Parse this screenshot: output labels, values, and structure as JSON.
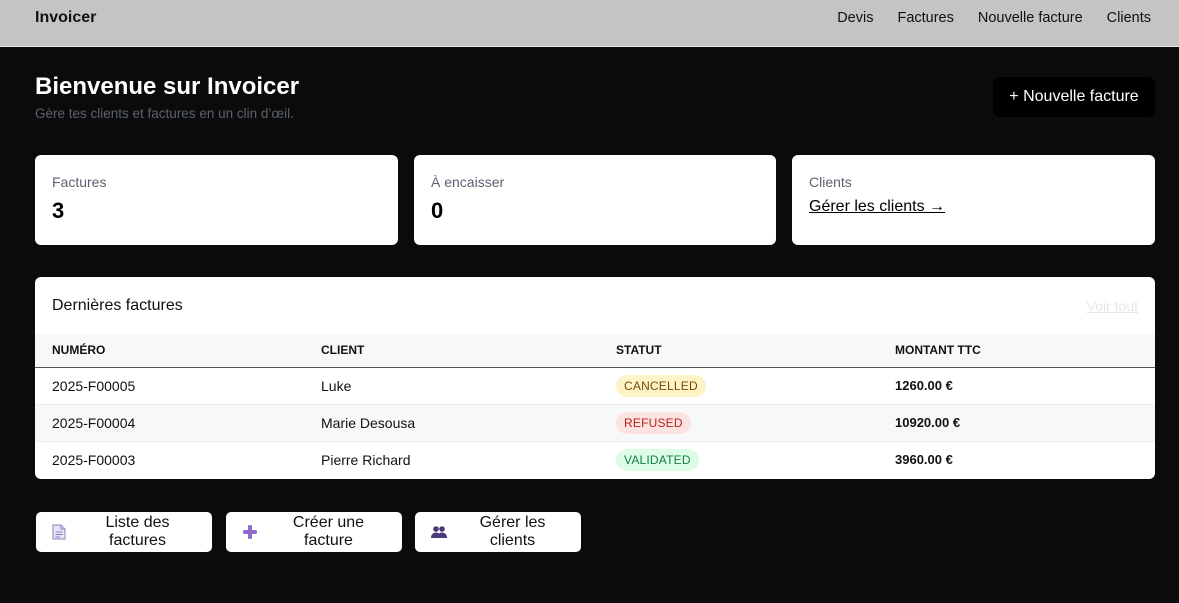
{
  "app": {
    "brand": "Invoicer"
  },
  "nav": {
    "items": [
      "Devis",
      "Factures",
      "Nouvelle facture",
      "Clients"
    ]
  },
  "hero": {
    "title": "Bienvenue sur Invoicer",
    "subtitle": "Gère tes clients et factures en un clin d’œil.",
    "new_invoice_button": "+ Nouvelle facture"
  },
  "stats": {
    "invoices": {
      "label": "Factures",
      "value": "3"
    },
    "to_collect": {
      "label": "À encaisser",
      "value": "0"
    },
    "clients": {
      "label": "Clients",
      "link": "Gérer les clients →"
    }
  },
  "recent": {
    "title": "Dernières factures",
    "see_all": "Voir tout",
    "columns": [
      "NUMÉRO",
      "CLIENT",
      "STATUT",
      "MONTANT TTC"
    ],
    "rows": [
      {
        "number": "2025-F00005",
        "client": "Luke",
        "status": "CANCELLED",
        "amount": "1260.00 €"
      },
      {
        "number": "2025-F00004",
        "client": "Marie Desousa",
        "status": "REFUSED",
        "amount": "10920.00 €"
      },
      {
        "number": "2025-F00003",
        "client": "Pierre Richard",
        "status": "VALIDATED",
        "amount": "3960.00 €"
      }
    ]
  },
  "status_colors": {
    "CANCELLED": {
      "bg": "#fef3c7",
      "fg": "#7a4b05"
    },
    "REFUSED": {
      "bg": "#fde2e2",
      "fg": "#b42318"
    },
    "VALIDATED": {
      "bg": "#dcfce7",
      "fg": "#15803d"
    }
  },
  "quick_actions": [
    {
      "label": "Liste des factures",
      "icon": "document-icon"
    },
    {
      "label": "Créer une facture",
      "icon": "plus-icon"
    },
    {
      "label": "Gérer les clients",
      "icon": "people-icon"
    }
  ]
}
